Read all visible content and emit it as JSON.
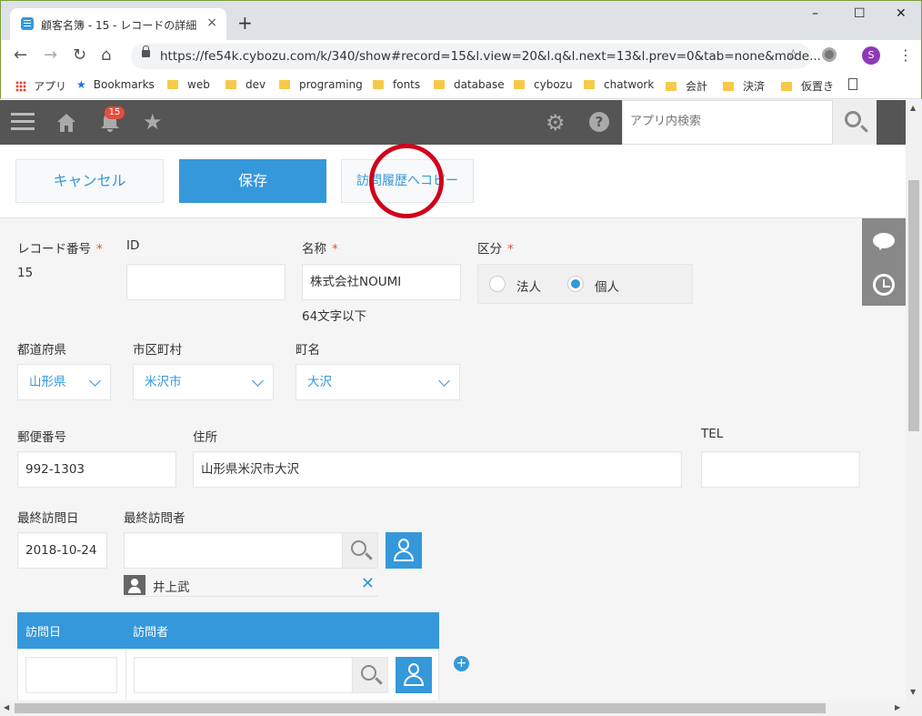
{
  "browser": {
    "tab_title": "顧客名簿 - 15 - レコードの詳細",
    "close_tab": "×",
    "new_tab": "+",
    "url": "https://fe54k.cybozu.com/k/340/show#record=15&l.view=20&l.q&l.next=13&l.prev=0&tab=none&mode...",
    "profile_initial": "S",
    "bookmarks": [
      "アプリ",
      "Bookmarks",
      "web",
      "dev",
      "programing",
      "fonts",
      "database",
      "cybozu",
      "chatwork",
      "会計",
      "決済",
      "仮置き"
    ]
  },
  "appbar": {
    "notification_count": "15",
    "search_placeholder": "アプリ内検索"
  },
  "actions": {
    "cancel": "キャンセル",
    "save": "保存",
    "copy": "訪問履歴へコピー"
  },
  "record": {
    "record_no_label": "レコード番号",
    "record_no": "15",
    "id_label": "ID",
    "id_value": "",
    "name_label": "名称",
    "name_value": "株式会社NOUMI",
    "name_hint": "64文字以下",
    "type_label": "区分",
    "type_options": [
      "法人",
      "個人"
    ],
    "type_selected": "個人",
    "required_mark": "*",
    "prefecture_label": "都道府県",
    "prefecture": "山形県",
    "city_label": "市区町村",
    "city": "米沢市",
    "town_label": "町名",
    "town": "大沢",
    "zip_label": "郵便番号",
    "zip": "992-1303",
    "address_label": "住所",
    "address": "山形県米沢市大沢",
    "tel_label": "TEL",
    "tel": "",
    "last_visit_label": "最終訪問日",
    "last_visit": "2018-10-24",
    "last_visitor_label": "最終訪問者",
    "last_visitor": "井上武",
    "table_headers": [
      "訪問日",
      "訪問者"
    ],
    "add_row": "+"
  },
  "colors": {
    "accent": "#3498db",
    "required": "#e74c3c",
    "annotation_circle": "#d0021b"
  }
}
